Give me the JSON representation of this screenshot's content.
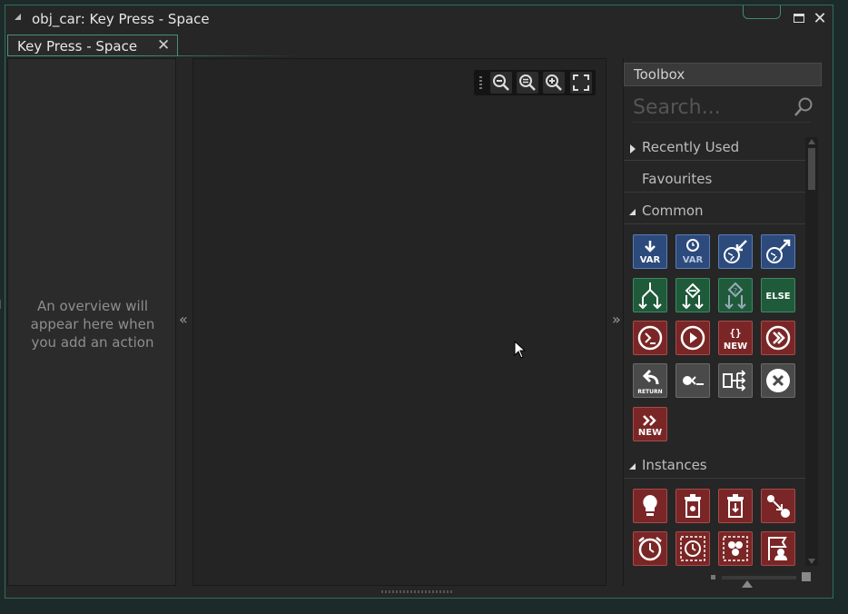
{
  "window": {
    "title": "obj_car: Key Press - Space"
  },
  "tab": {
    "label": "Key Press - Space",
    "close_glyph": "✕"
  },
  "overview": {
    "message": "An overview will appear here when you add an action"
  },
  "nav": {
    "collapse_left": "«",
    "collapse_right": "»"
  },
  "zoom_toolbar": {
    "icons": [
      "zoom-out-icon",
      "zoom-reset-icon",
      "zoom-in-icon",
      "fit-screen-icon"
    ]
  },
  "toolbox": {
    "title": "Toolbox",
    "search_placeholder": "Search...",
    "sections": {
      "recently_used": "Recently Used",
      "favourites": "Favourites",
      "common": "Common",
      "instances": "Instances"
    },
    "common_icons": [
      {
        "name": "assign-variable-icon",
        "color": "blue",
        "text": "VAR"
      },
      {
        "name": "temp-variable-icon",
        "color": "blue",
        "text": "VAR"
      },
      {
        "name": "get-global-icon",
        "color": "blue",
        "text": ""
      },
      {
        "name": "set-global-icon",
        "color": "blue",
        "text": ""
      },
      {
        "name": "if-variable-icon",
        "color": "green",
        "text": ""
      },
      {
        "name": "if-expression-icon",
        "color": "green",
        "text": ""
      },
      {
        "name": "if-undefined-icon",
        "color": "green",
        "text": ""
      },
      {
        "name": "else-icon",
        "color": "green",
        "text": "ELSE"
      },
      {
        "name": "execute-code-icon",
        "color": "red",
        "text": ""
      },
      {
        "name": "run-script-icon",
        "color": "red",
        "text": ""
      },
      {
        "name": "declare-function-icon",
        "color": "red",
        "text": "NEW"
      },
      {
        "name": "call-function-icon",
        "color": "red",
        "text": ""
      },
      {
        "name": "return-icon",
        "color": "gray",
        "text": "RETURN"
      },
      {
        "name": "comment-icon",
        "color": "gray",
        "text": ""
      },
      {
        "name": "switch-icon",
        "color": "gray",
        "text": ""
      },
      {
        "name": "exit-event-icon",
        "color": "gray",
        "text": ""
      },
      {
        "name": "new-constructor-icon",
        "color": "red",
        "text": "NEW"
      }
    ],
    "instance_icons": [
      {
        "name": "create-instance-icon",
        "color": "red"
      },
      {
        "name": "destroy-instance-icon",
        "color": "red"
      },
      {
        "name": "destroy-at-position-icon",
        "color": "red"
      },
      {
        "name": "change-instance-icon",
        "color": "red"
      },
      {
        "name": "set-alarm-icon",
        "color": "red"
      },
      {
        "name": "get-alarm-icon",
        "color": "red"
      },
      {
        "name": "instance-count-icon",
        "color": "red"
      },
      {
        "name": "set-instance-variable-icon",
        "color": "red"
      }
    ]
  }
}
